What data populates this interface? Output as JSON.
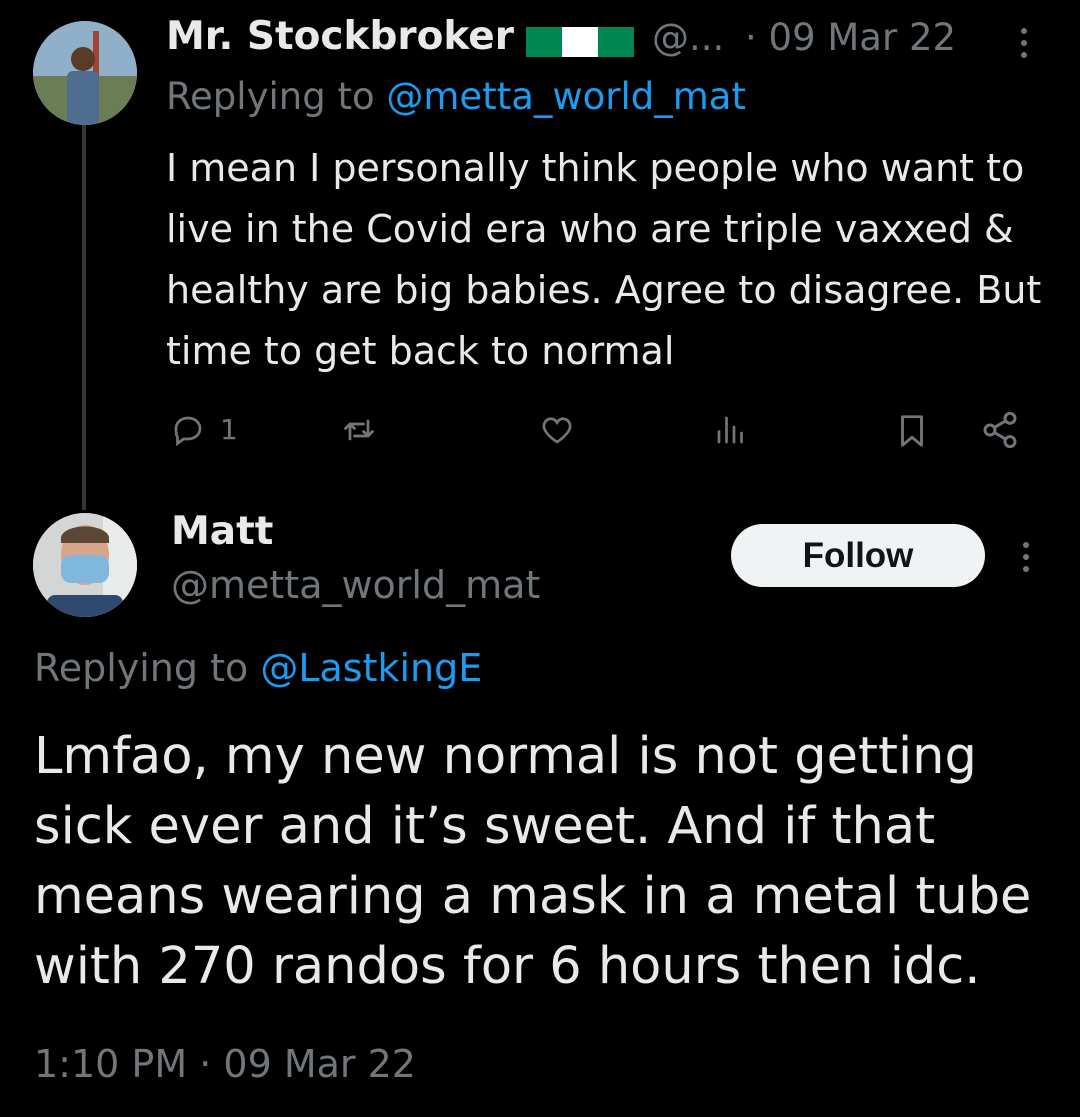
{
  "tweet1": {
    "author_name": "Mr. Stockbroker",
    "handle": "@...",
    "separator": "·",
    "date": "09 Mar 22",
    "replying_prefix": "Replying to",
    "replying_to": "@metta_world_mat",
    "text": "I mean I personally think people who want to live in the Covid era who are triple vaxxed & healthy are big babies. Agree to disagree. But time to get back to normal",
    "reply_count": "1",
    "flag_colors": [
      "#008751",
      "#ffffff",
      "#008751"
    ],
    "icons": [
      "reply-icon",
      "retweet-icon",
      "like-icon",
      "views-icon",
      "bookmark-icon",
      "share-icon",
      "more-icon"
    ]
  },
  "tweet2": {
    "author_name": "Matt",
    "handle": "@metta_world_mat",
    "follow_label": "Follow",
    "replying_prefix": "Replying to",
    "replying_to": "@LastkingE",
    "text": "Lmfao, my new normal is not getting sick ever and it’s sweet. And if that means wearing a mask in a metal tube with 270 randos for 6 hours then idc.",
    "time": "1:10 PM",
    "separator": "·",
    "date": "09 Mar 22"
  },
  "colors": {
    "background": "#000000",
    "primary_text": "#e7e9ea",
    "secondary_text": "#71767b",
    "link": "#1d9bf0",
    "follow_button_bg": "#eff3f4"
  }
}
